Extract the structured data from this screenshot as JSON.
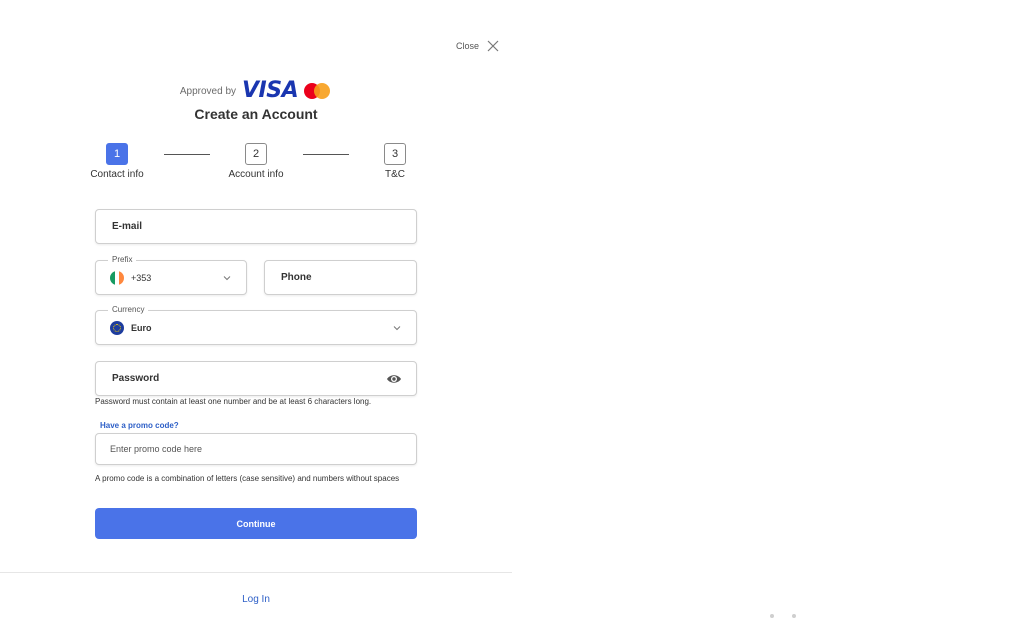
{
  "header": {
    "close_label": "Close",
    "approved_by": "Approved by",
    "visa_text": "VISA",
    "title": "Create an Account"
  },
  "steps": [
    {
      "num": "1",
      "label": "Contact info",
      "active": true
    },
    {
      "num": "2",
      "label": "Account info",
      "active": false
    },
    {
      "num": "3",
      "label": "T&C",
      "active": false
    }
  ],
  "form": {
    "email_label": "E-mail",
    "prefix_legend": "Prefix",
    "prefix_value": "+353",
    "phone_label": "Phone",
    "currency_legend": "Currency",
    "currency_value": "Euro",
    "password_label": "Password",
    "password_hint": "Password must contain at least one number and be at least 6 characters long.",
    "promo_link": "Have a promo code?",
    "promo_placeholder": "Enter promo code here",
    "promo_hint": "A promo code is a combination of letters (case sensitive) and numbers without spaces",
    "continue_label": "Continue"
  },
  "footer": {
    "login_label": "Log In"
  },
  "colors": {
    "accent": "#4a73e8",
    "link": "#2d5fc7",
    "visa": "#1a36b0"
  },
  "icons": [
    "close-icon",
    "ireland-flag-icon",
    "chevron-down-icon",
    "eu-flag-icon",
    "eye-icon",
    "mastercard-logo"
  ]
}
